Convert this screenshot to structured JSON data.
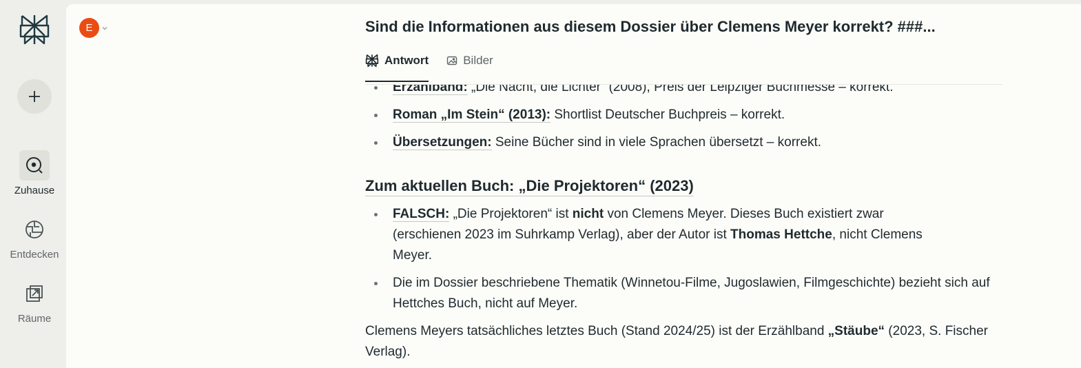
{
  "sidebar": {
    "nav": [
      {
        "label": "Zuhause",
        "icon": "home-search-icon",
        "active": true
      },
      {
        "label": "Entdecken",
        "icon": "globe-icon",
        "active": false
      },
      {
        "label": "Räume",
        "icon": "spaces-icon",
        "active": false
      }
    ]
  },
  "user": {
    "initial": "E"
  },
  "header": {
    "title": "Sind die Informationen aus diesem Dossier über Clemens Meyer korrekt? ###...",
    "tabs": [
      {
        "label": "Antwort",
        "icon": "logo-icon"
      },
      {
        "label": "Bilder",
        "icon": "image-icon"
      }
    ]
  },
  "answer": {
    "list1": [
      {
        "term": "Erzählband:",
        "text": " „Die Nacht, die Lichter“ (2008), Preis der Leipziger Buchmesse – korrekt."
      },
      {
        "term": "Roman „Im Stein“ (2013):",
        "text": " Shortlist Deutscher Buchpreis – korrekt."
      },
      {
        "term": "Übersetzungen:",
        "text": " Seine Bücher sind in viele Sprachen übersetzt – korrekt."
      }
    ],
    "heading": "Zum aktuellen Buch: „Die Projektoren“ (2023)",
    "falsch": {
      "term": "FALSCH:",
      "t1": " „Die Projektoren“ ist ",
      "b1": "nicht",
      "t2": " von Clemens Meyer. Dieses Buch existiert zwar (erschienen 2023 im Suhrkamp Verlag), aber der Autor ist ",
      "b2": "Thomas Hettche",
      "t3": ", nicht Clemens Meyer."
    },
    "thema": "Die im Dossier beschriebene Thematik (Winnetou-Filme, Jugoslawien, Filmgeschichte) bezieht sich auf Hettches Buch, nicht auf Meyer.",
    "closing": {
      "t1": "Clemens Meyers tatsächliches letztes Buch (Stand 2024/25) ist der Erzählband ",
      "b1": "„Stäube“",
      "t2": " (2023, S. Fischer Verlag)."
    }
  }
}
